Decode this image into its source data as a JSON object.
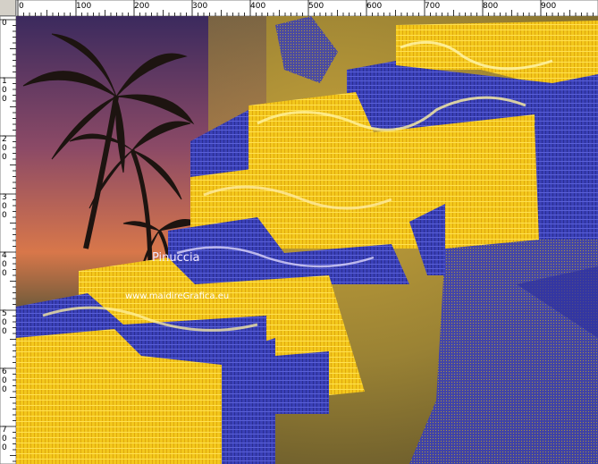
{
  "rulers": {
    "top_labels": [
      "0",
      "100",
      "200",
      "300",
      "400",
      "500",
      "600",
      "700",
      "800",
      "900"
    ],
    "left_labels": [
      "0",
      "1 0 0",
      "2 0 0",
      "3 0 0",
      "4 0 0",
      "5 0 0",
      "6 0 0",
      "7 0 0"
    ],
    "colors": {
      "background": "#ffffff",
      "ticks": "#000000",
      "frame": "#d4d0c8"
    }
  },
  "artwork": {
    "watermark_name": "Pinuccia",
    "watermark_url": "www.maidireGrafica.eu",
    "colors": {
      "sky_top": "#3c2a63",
      "sky_glow": "#e07a4a",
      "gold": "#f2c51a",
      "blue": "#3a3fb4",
      "sand": "#8c7a32"
    }
  }
}
